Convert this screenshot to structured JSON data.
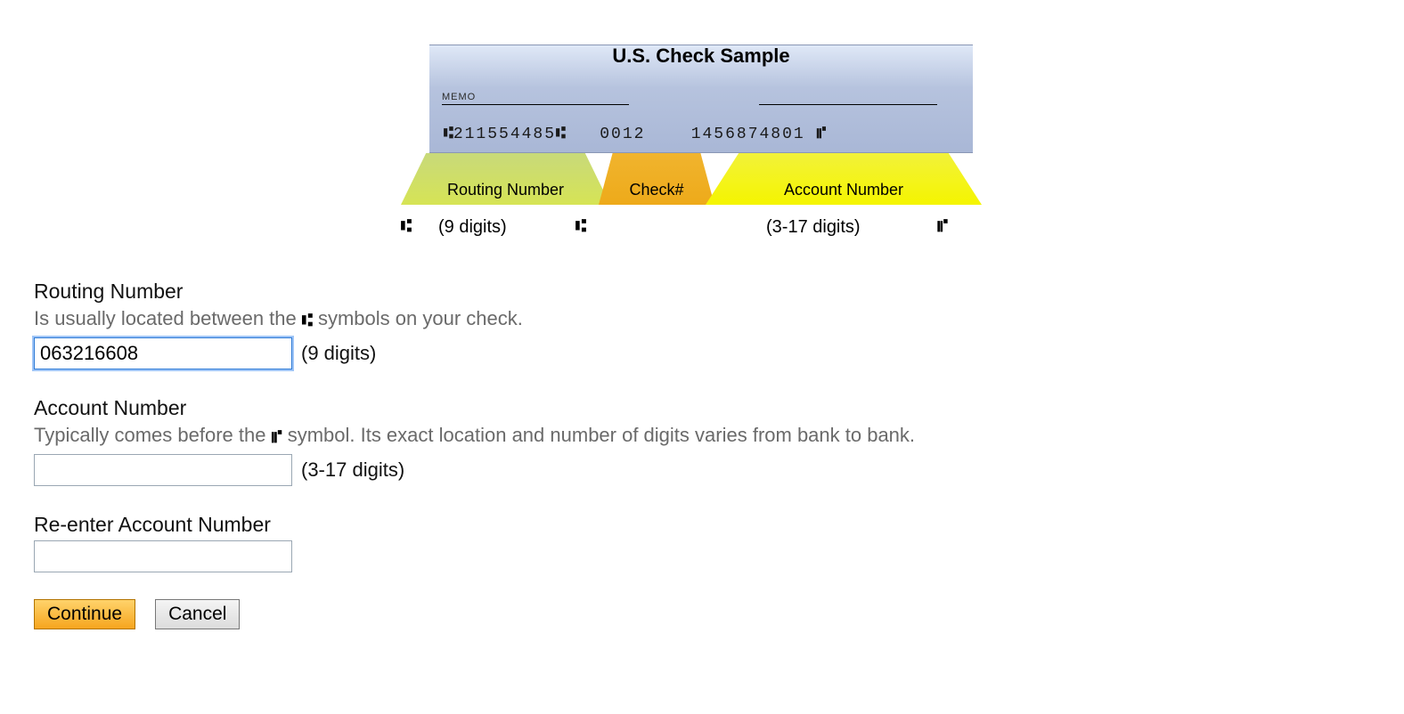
{
  "sample": {
    "title": "U.S. Check Sample",
    "memo_label": "MEMO",
    "micr_routing": "211554485",
    "micr_check": "0012",
    "micr_account": "1456874801",
    "callout_routing": "Routing Number",
    "callout_check": "Check#",
    "callout_account": "Account Number",
    "routing_digits_hint": "(9 digits)",
    "account_digits_hint": "(3-17 digits)",
    "transit_symbol": "⑆",
    "onus_symbol": "⑈"
  },
  "form": {
    "routing": {
      "label": "Routing Number",
      "help_pre": "Is usually located between the ",
      "help_post": " symbols on your check.",
      "help_symbol": "⑆",
      "value": "063216608",
      "digit_hint": "(9 digits)"
    },
    "account": {
      "label": "Account Number",
      "help_pre": "Typically comes before the ",
      "help_post": " symbol. Its exact location and number of digits varies from bank to bank.",
      "help_symbol": "⑈",
      "value": "",
      "digit_hint": "(3-17 digits)"
    },
    "reenter": {
      "label": "Re-enter Account Number",
      "value": ""
    },
    "buttons": {
      "continue": "Continue",
      "cancel": "Cancel"
    }
  }
}
